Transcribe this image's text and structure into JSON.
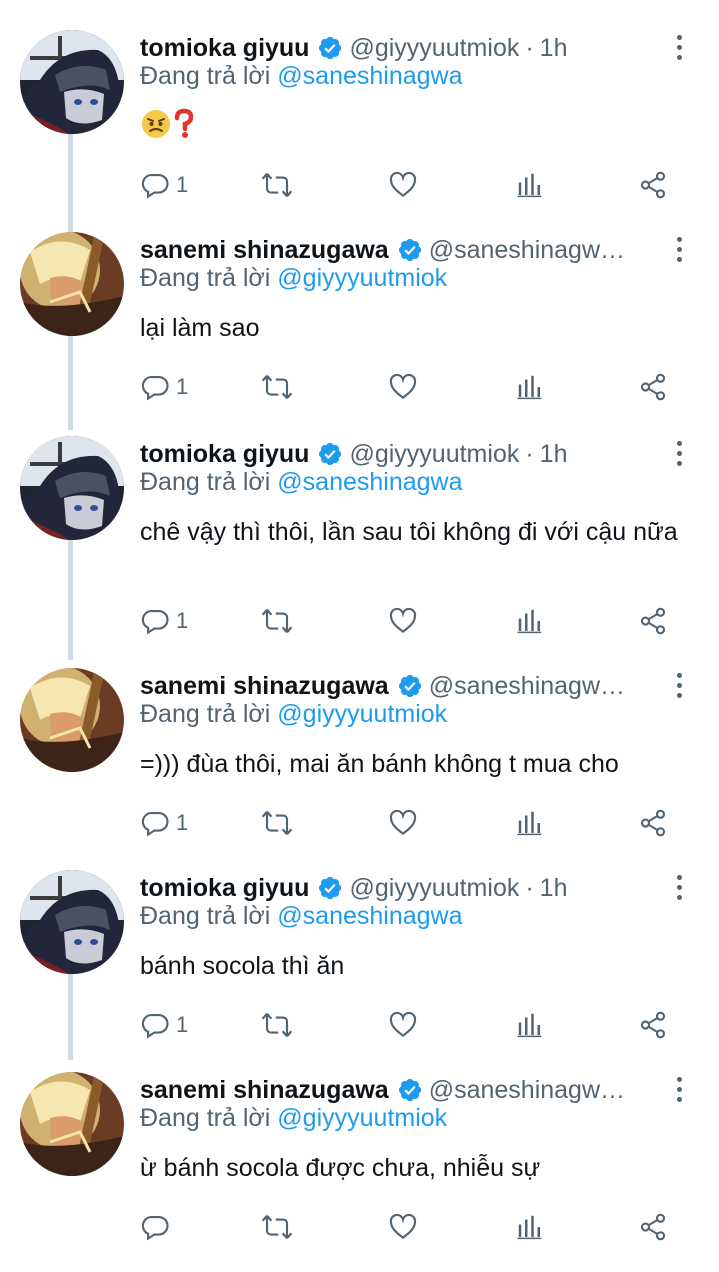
{
  "thread": [
    {
      "author": "tomioka",
      "name": "tomioka giyuu",
      "handle": "@giyyyuutmiok",
      "separator": "·",
      "time": "1h",
      "reply_prefix": "Đang trả lời",
      "reply_to": "@saneshinagwa",
      "text": "",
      "emoji": [
        "angry-face",
        "red-question-mark"
      ],
      "reply_count": "1"
    },
    {
      "author": "sanemi",
      "name": "sanemi shinazugawa",
      "handle": "@saneshinagw…",
      "separator": "",
      "time": "",
      "reply_prefix": "Đang trả lời",
      "reply_to": "@giyyyuutmiok",
      "text": "lại làm sao",
      "reply_count": "1"
    },
    {
      "author": "tomioka",
      "name": "tomioka giyuu",
      "handle": "@giyyyuutmiok",
      "separator": "·",
      "time": "1h",
      "reply_prefix": "Đang trả lời",
      "reply_to": "@saneshinagwa",
      "text": "chê vậy thì thôi, lần sau tôi không đi với cậu nữa",
      "reply_count": "1"
    },
    {
      "author": "sanemi",
      "name": "sanemi shinazugawa",
      "handle": "@saneshinagw…",
      "separator": "",
      "time": "",
      "reply_prefix": "Đang trả lời",
      "reply_to": "@giyyyuutmiok",
      "text": "=))) đùa thôi, mai ăn bánh không t mua cho",
      "reply_count": "1"
    },
    {
      "author": "tomioka",
      "name": "tomioka giyuu",
      "handle": "@giyyyuutmiok",
      "separator": "·",
      "time": "1h",
      "reply_prefix": "Đang trả lời",
      "reply_to": "@saneshinagwa",
      "text": "bánh socola thì ăn",
      "reply_count": "1"
    },
    {
      "author": "sanemi",
      "name": "sanemi shinazugawa",
      "handle": "@saneshinagw…",
      "separator": "",
      "time": "",
      "reply_prefix": "Đang trả lời",
      "reply_to": "@giyyyuutmiok",
      "text": "ừ bánh socola được chưa, nhiễu sự",
      "reply_count": ""
    }
  ],
  "colors": {
    "accent": "#1d9bf0",
    "muted": "#536471",
    "thread_line": "#cfd9de"
  },
  "icons": [
    "verified-badge-icon",
    "more-icon",
    "reply-icon",
    "retweet-icon",
    "like-icon",
    "views-icon",
    "share-icon"
  ]
}
